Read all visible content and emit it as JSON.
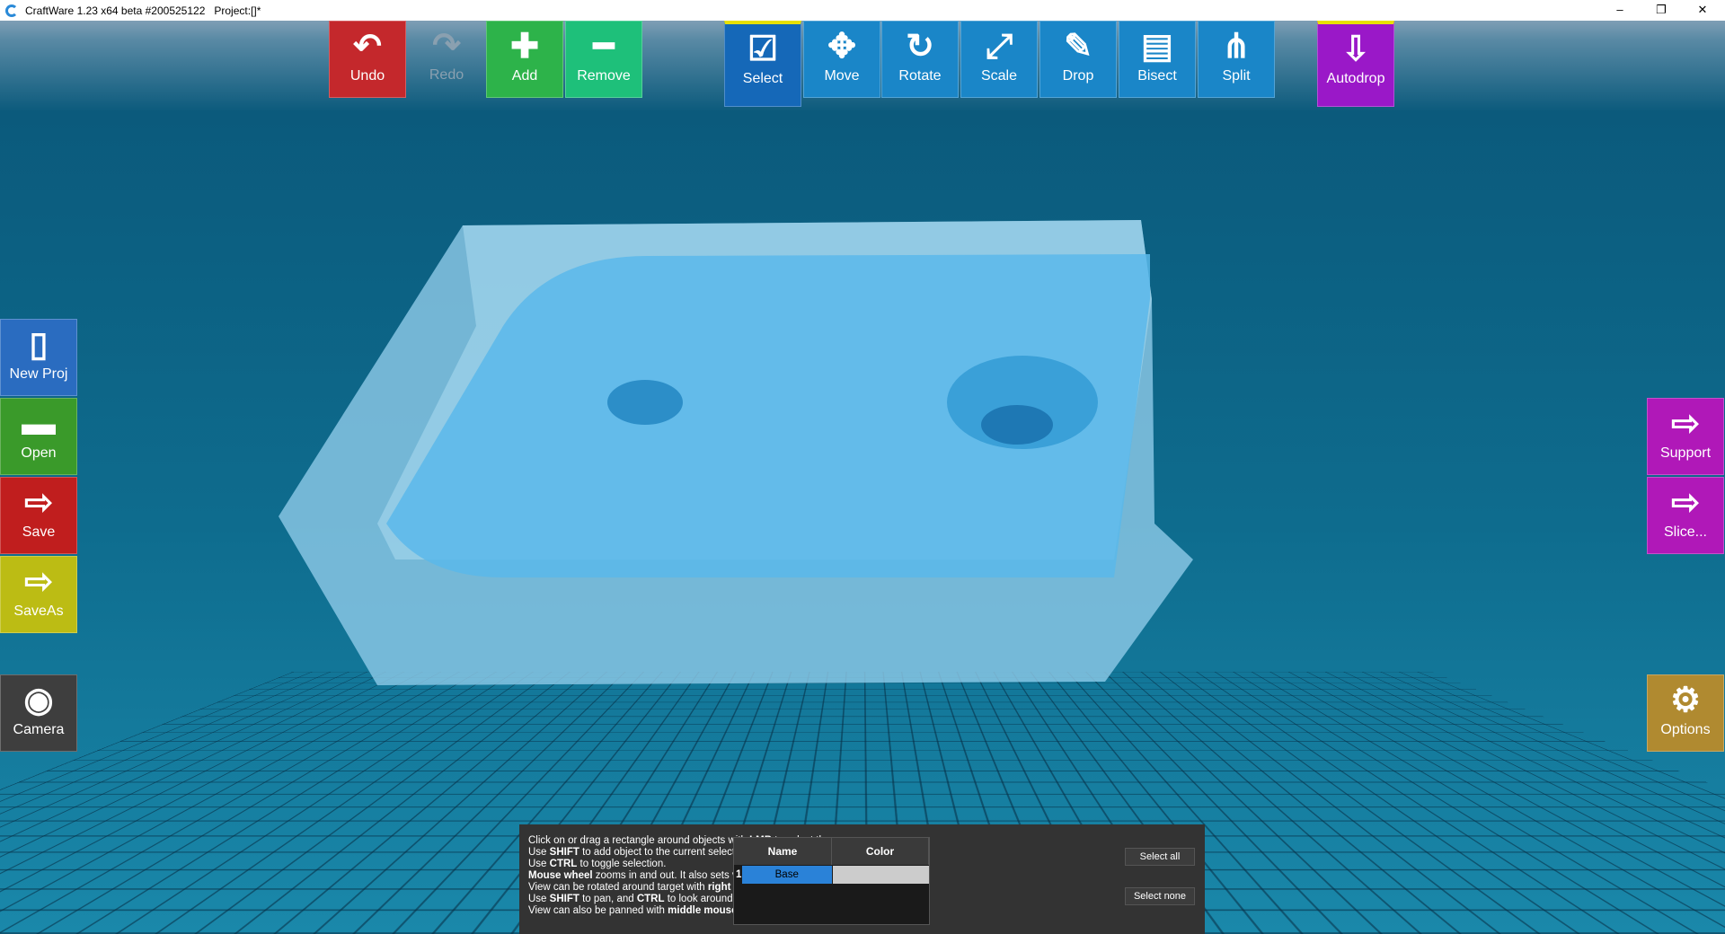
{
  "titlebar": {
    "title": "CraftWare 1.23 x64 beta #200525122   Project:[]*",
    "minimize": "–",
    "restore": "❐",
    "close": "✕"
  },
  "toolbar": [
    {
      "id": "undo",
      "label": "Undo",
      "icon": "↶",
      "color": "#c4282c"
    },
    {
      "id": "redo",
      "label": "Redo",
      "icon": "↷",
      "color": "transparent"
    },
    {
      "id": "add",
      "label": "Add",
      "icon": "✚",
      "color": "#2db34a"
    },
    {
      "id": "remove",
      "label": "Remove",
      "icon": "━",
      "color": "#1ec07a"
    },
    {
      "id": "select",
      "label": "Select",
      "icon": "☑",
      "color": "#1568b8"
    },
    {
      "id": "move",
      "label": "Move",
      "icon": "✥",
      "color": "#1a86c8"
    },
    {
      "id": "rotate",
      "label": "Rotate",
      "icon": "↻",
      "color": "#1a86c8"
    },
    {
      "id": "scale",
      "label": "Scale",
      "icon": "⤢",
      "color": "#1a86c8"
    },
    {
      "id": "drop",
      "label": "Drop",
      "icon": "✎",
      "color": "#1a86c8"
    },
    {
      "id": "bisect",
      "label": "Bisect",
      "icon": "▤",
      "color": "#1a86c8"
    },
    {
      "id": "split",
      "label": "Split",
      "icon": "⋔",
      "color": "#1a86c8"
    },
    {
      "id": "autodrop",
      "label": "Autodrop",
      "icon": "⇩",
      "color": "#9a18c8"
    }
  ],
  "left": [
    {
      "id": "new-proj",
      "label": "New Proj",
      "icon": "▯",
      "color": "#2a6cc0"
    },
    {
      "id": "open",
      "label": "Open",
      "icon": "▬",
      "color": "#3a9a2a"
    },
    {
      "id": "save",
      "label": "Save",
      "icon": "⇨",
      "color": "#c01e1e"
    },
    {
      "id": "saveas",
      "label": "SaveAs",
      "icon": "⇨",
      "color": "#bcbc14"
    },
    {
      "id": "camera",
      "label": "Camera",
      "icon": "◉",
      "color": "#3e3e3e"
    }
  ],
  "right": [
    {
      "id": "support",
      "label": "Support",
      "icon": "⇨",
      "color": "#b018b8"
    },
    {
      "id": "slice",
      "label": "Slice...",
      "icon": "⇨",
      "color": "#b018b8"
    },
    {
      "id": "options",
      "label": "Options",
      "icon": "⚙",
      "color": "#b08a30"
    }
  ],
  "help": [
    [
      "Click on or drag a rectangle around objects with ",
      "LMB",
      " to select them."
    ],
    [
      "Use ",
      "SHIFT",
      " to add object to the current selection."
    ],
    [
      "Use ",
      "CTRL",
      " to toggle selection."
    ],
    [
      "",
      "Mouse wheel",
      " zooms in and out. It also sets viewing target."
    ],
    [
      "View can be rotated around target with ",
      "right mouse button",
      "."
    ],
    [
      "Use ",
      "SHIFT",
      " to pan, and ",
      "CTRL",
      " to look around."
    ],
    [
      "View can also be panned with ",
      "middle mouse button",
      "."
    ]
  ],
  "objects": {
    "headers": {
      "name": "Name",
      "color": "Color"
    },
    "rows": [
      {
        "index": "1",
        "name": "Base",
        "color": "#cccccc"
      }
    ]
  },
  "buttons": {
    "select_all": "Select all",
    "select_none": "Select none"
  }
}
